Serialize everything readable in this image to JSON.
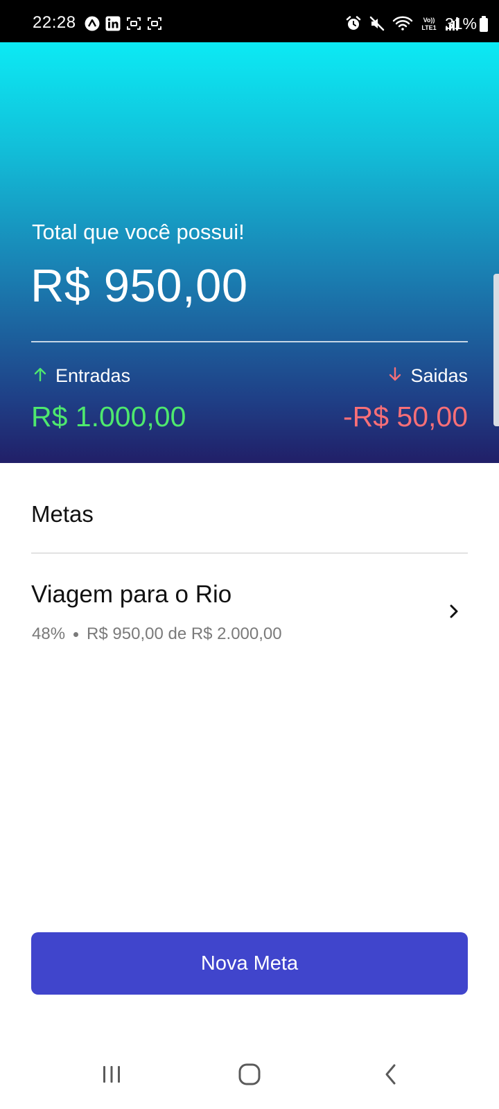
{
  "status_bar": {
    "time": "22:28",
    "battery": "31%",
    "left_icons": [
      "expo-icon",
      "linkedin-icon",
      "screenshot-icon",
      "screenshot-icon"
    ],
    "right_icons": [
      "alarm-icon",
      "mute-icon",
      "wifi-icon",
      "volte-icon",
      "signal-icon"
    ]
  },
  "balance": {
    "label": "Total que você possui!",
    "value": "R$ 950,00"
  },
  "income": {
    "label": "Entradas",
    "value": "R$ 1.000,00",
    "icon": "arrow-up-icon",
    "color": "#4ee86e"
  },
  "expense": {
    "label": "Saidas",
    "value": "-R$ 50,00",
    "icon": "arrow-down-icon",
    "color": "#f86f77"
  },
  "goals": {
    "title": "Metas",
    "items": [
      {
        "name": "Viagem para o Rio",
        "percent": "48%",
        "progress_text": "R$ 950,00 de R$ 2.000,00"
      }
    ]
  },
  "actions": {
    "new_goal_label": "Nova Meta",
    "button_color": "#4045cc"
  },
  "nav": {
    "items": [
      "recents-icon",
      "home-icon",
      "back-icon"
    ]
  }
}
